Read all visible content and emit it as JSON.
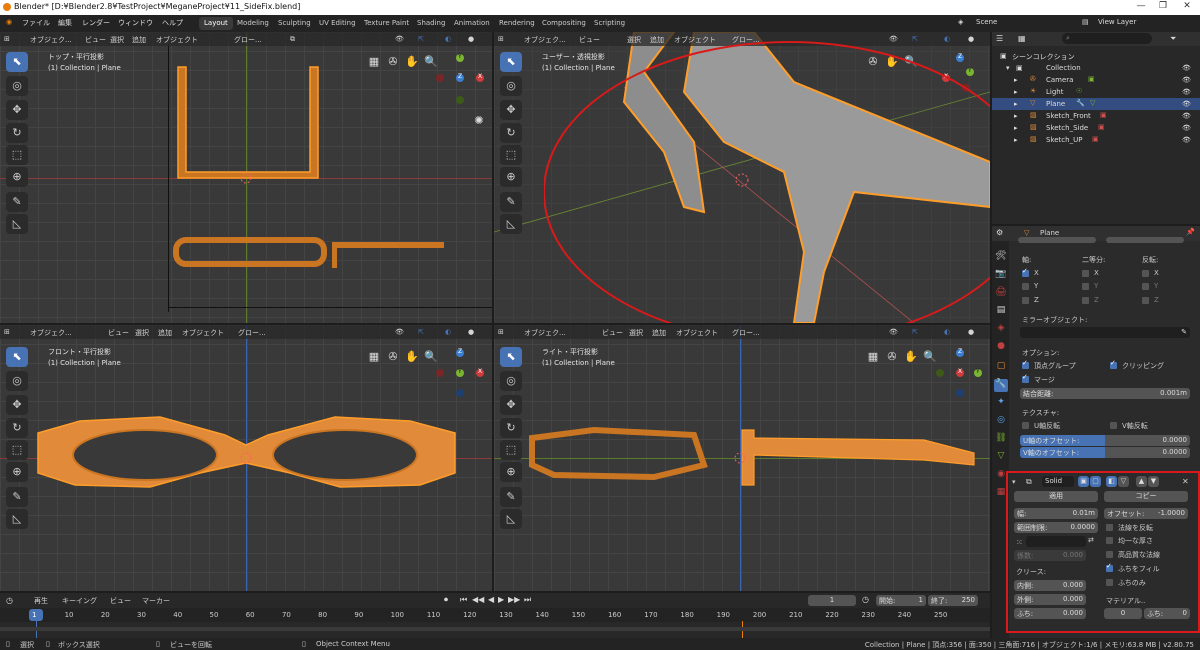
{
  "window": {
    "title": "Blender* [D:¥Blender2.8¥TestProject¥MeganeProject¥11_SideFix.blend]",
    "min": "—",
    "max": "❐",
    "close": "✕"
  },
  "menubar": {
    "items": [
      "ファイル",
      "編集",
      "レンダー",
      "ウィンドウ",
      "ヘルプ"
    ]
  },
  "workspaces": [
    "Layout",
    "Modeling",
    "Sculpting",
    "UV Editing",
    "Texture Paint",
    "Shading",
    "Animation",
    "Rendering",
    "Compositing",
    "Scripting"
  ],
  "scene": {
    "label": "Scene",
    "viewlayer": "View Layer"
  },
  "viewport_header": {
    "mode": "オブジェク...",
    "view": "ビュー",
    "select": "選択",
    "add": "追加",
    "object": "オブジェクト",
    "orientation": "グロー..."
  },
  "viewports": {
    "top": {
      "title": "トップ・平行投影",
      "collection": "(1) Collection | Plane"
    },
    "user": {
      "title": "ユーザー・透視投影",
      "collection": "(1) Collection | Plane"
    },
    "front": {
      "title": "フロント・平行投影",
      "collection": "(1) Collection | Plane"
    },
    "right": {
      "title": "ライト・平行投影",
      "collection": "(1) Collection | Plane"
    }
  },
  "gizmo": {
    "z": "Z",
    "y": "Y",
    "x": "X"
  },
  "outliner": {
    "root": "シーンコレクション",
    "items": [
      {
        "label": "Collection",
        "indent": 1
      },
      {
        "label": "Camera",
        "indent": 2
      },
      {
        "label": "Light",
        "indent": 2
      },
      {
        "label": "Plane",
        "indent": 2,
        "selected": true
      },
      {
        "label": "Sketch_Front",
        "indent": 2
      },
      {
        "label": "Sketch_Side",
        "indent": 2
      },
      {
        "label": "Sketch_UP",
        "indent": 2
      }
    ]
  },
  "properties": {
    "object": "Plane",
    "mirror": {
      "axis_label": "軸:",
      "bisect_label": "二等分:",
      "flip_label": "反転:",
      "x": "X",
      "y": "Y",
      "z": "Z",
      "mirror_object": "ミラーオブジェクト:",
      "options": "オプション:",
      "vertex_groups": "頂点グループ",
      "clipping": "クリッピング",
      "merge": "マージ",
      "merge_distance_label": "結合距離:",
      "merge_distance": "0.001m",
      "textures": "テクスチャ:",
      "u_flip": "U軸反転",
      "v_flip": "V軸反転",
      "u_offset_label": "U軸のオフセット:",
      "u_offset": "0.0000",
      "v_offset_label": "V軸のオフセット:",
      "v_offset": "0.0000"
    },
    "solidify": {
      "name": "Solid",
      "apply": "適用",
      "copy": "コピー",
      "width_label": "幅:",
      "width": "0.01m",
      "offset_label": "オフセット:",
      "offset": "-1.0000",
      "clamp_label": "範囲制限:",
      "clamp": "0.0000",
      "flip_normals": "法線を反転",
      "even": "均一な厚さ",
      "high_quality": "高品質な法線",
      "fill_rim": "ふちをフィル",
      "only_rim": "ふちのみ",
      "factor_label": "係数:",
      "factor": "0.000",
      "crease": "クリース:",
      "inner_label": "内側:",
      "inner": "0.000",
      "outer_label": "外側:",
      "outer": "0.000",
      "rim_label": "ふち:",
      "rim": "0.000",
      "material": "マテリアル..",
      "mat_value": "0",
      "rim_mat_label": "ふち:",
      "rim_mat": "0"
    }
  },
  "timeline": {
    "menus": [
      "再生",
      "キーイング",
      "ビュー",
      "マーカー"
    ],
    "current": "1",
    "start_label": "開始:",
    "start": "1",
    "end_label": "終了:",
    "end": "250",
    "ticks": [
      "1",
      "10",
      "20",
      "30",
      "40",
      "50",
      "60",
      "70",
      "80",
      "90",
      "100",
      "110",
      "120",
      "130",
      "140",
      "150",
      "160",
      "170",
      "180",
      "190",
      "200",
      "210",
      "220",
      "230",
      "240",
      "250"
    ]
  },
  "status": {
    "select": "選択",
    "box": "ボックス選択",
    "rotate": "ビューを回転",
    "context": "Object Context Menu",
    "stats": "Collection | Plane | 頂点:356 | 面:350 | 三角面:716 | オブジェクト:1/6 | メモリ:63.8 MB | v2.80.75"
  },
  "colors": {
    "accent": "#4772b3",
    "selection": "#e87d0d",
    "highlight_box": "#d71a1a"
  }
}
